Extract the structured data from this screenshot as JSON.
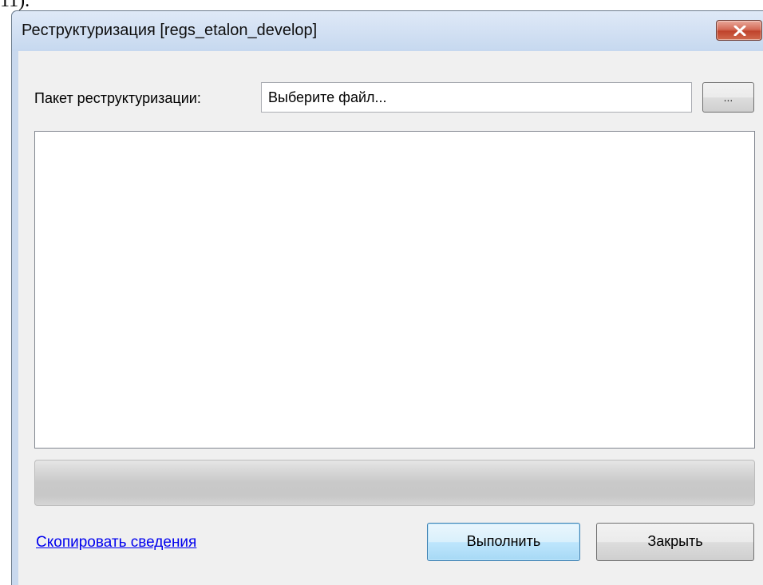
{
  "page_fragment": "11).",
  "window": {
    "title": "Реструктуризация [regs_etalon_develop]"
  },
  "form": {
    "package_label": "Пакет реструктуризации:",
    "file_input_value": "Выберите файл...",
    "browse_label": "..."
  },
  "log": {
    "content": ""
  },
  "progress": {
    "value_fraction": 0
  },
  "footer": {
    "copy_link": "Скопировать сведения",
    "run_label": "Выполнить",
    "close_label": "Закрыть"
  },
  "colors": {
    "titlebar": "#c6d8ef",
    "close_button": "#c0432c",
    "link": "#0000ee",
    "client_background": "#f0f0f0"
  },
  "icons": {
    "close": "close-x-icon"
  }
}
